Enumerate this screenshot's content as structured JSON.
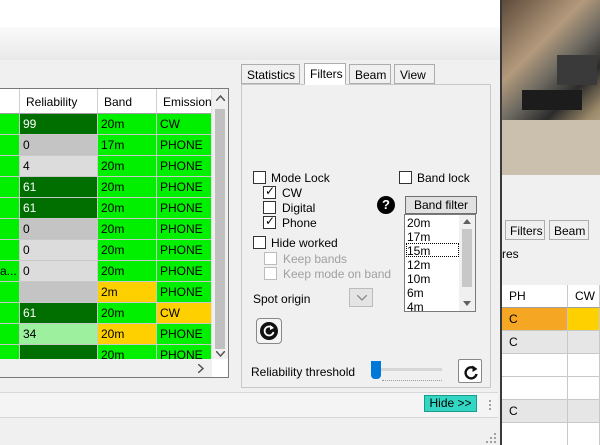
{
  "grid": {
    "headers": [
      "Reliability",
      "Band",
      "Emission"
    ],
    "truncated_cell": "a...",
    "rows": [
      {
        "reliability": "99",
        "band": "20m",
        "emission": "CW"
      },
      {
        "reliability": "0",
        "band": "17m",
        "emission": "PHONE"
      },
      {
        "reliability": "4",
        "band": "20m",
        "emission": "PHONE"
      },
      {
        "reliability": "61",
        "band": "20m",
        "emission": "PHONE"
      },
      {
        "reliability": "61",
        "band": "20m",
        "emission": "PHONE"
      },
      {
        "reliability": "0",
        "band": "20m",
        "emission": "PHONE"
      },
      {
        "reliability": "0",
        "band": "20m",
        "emission": "PHONE"
      },
      {
        "reliability": "0",
        "band": "20m",
        "emission": "PHONE"
      },
      {
        "reliability": "",
        "band": "2m",
        "emission": "PHONE"
      },
      {
        "reliability": "61",
        "band": "20m",
        "emission": "CW"
      },
      {
        "reliability": "34",
        "band": "20m",
        "emission": "PHONE"
      },
      {
        "reliability": "",
        "band": "20m",
        "emission": "PHONE"
      }
    ]
  },
  "tabs": [
    "Statistics",
    "Filters",
    "Beam",
    "View"
  ],
  "active_tab": "Filters",
  "filters": {
    "mode_lock": "Mode Lock",
    "cw": "CW",
    "digital": "Digital",
    "phone": "Phone",
    "hide_worked": "Hide worked",
    "keep_bands": "Keep bands",
    "keep_mode_on_band": "Keep mode on band",
    "band_lock": "Band lock",
    "band_filter_button": "Band filter",
    "bands": [
      "20m",
      "17m",
      "15m",
      "12m",
      "10m",
      "6m",
      "4m"
    ],
    "selected_band": "15m",
    "spot_origin": "Spot origin",
    "reliability_threshold": "Reliability threshold",
    "reliability_threshold_level": 0.05
  },
  "hide_button": "Hide >>",
  "right_window": {
    "tabs": [
      "Filters",
      "Beam"
    ],
    "partial_text": "res",
    "grid_headers": [
      "PH",
      "CW"
    ],
    "cells": [
      "C",
      "C",
      "C"
    ]
  },
  "colors": {
    "green": "#00f000",
    "dark_green": "#006f00",
    "light_green": "#9df09d",
    "gray": "#c4c4c4",
    "yellow": "#ffd000",
    "orange": "#f5a623",
    "hide_button": "#33d6c2",
    "slider_thumb": "#0078d7"
  },
  "icons": {
    "help": "question-circle-icon",
    "refresh": "refresh-icon",
    "reset": "reset-icon"
  }
}
